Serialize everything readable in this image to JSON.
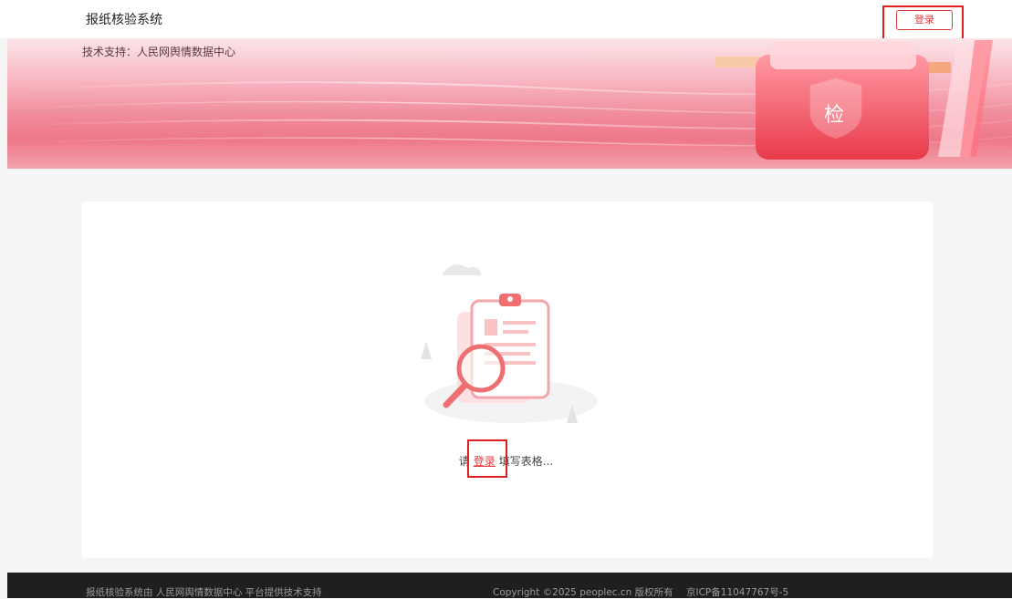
{
  "header": {
    "app_title": "报纸核验系统",
    "login_label": "登录"
  },
  "banner": {
    "support_text": "技术支持：人民网舆情数据中心",
    "icon_char": "检"
  },
  "main": {
    "prompt_prefix": "请",
    "prompt_link": "登录",
    "prompt_suffix": "填写表格..."
  },
  "footer": {
    "left_text": "报纸核验系统由  人民网舆情数据中心  平台提供技术支持",
    "copyright": "Copyright ©2025 peoplec.cn 版权所有",
    "icp": "京ICP备11047767号-5"
  },
  "colors": {
    "accent": "#e4393c",
    "highlight_box": "#e02020",
    "footer_bg": "#1f1f1f"
  }
}
